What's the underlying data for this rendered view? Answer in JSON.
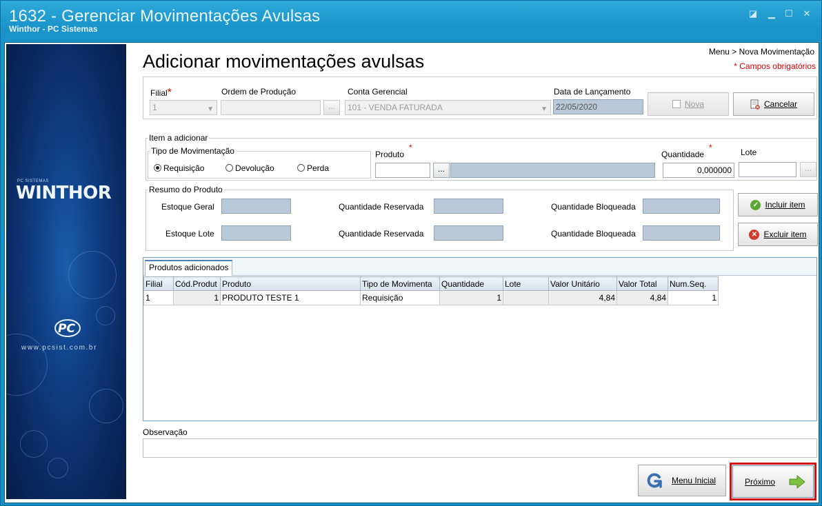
{
  "window": {
    "title": "1632 - Gerenciar Movimentações Avulsas",
    "subtitle": "Winthor - PC Sistemas"
  },
  "sidebar": {
    "brand_small": "PC SISTEMAS",
    "brand": "WINTHOR",
    "website": "www.pcsist.com.br"
  },
  "header": {
    "breadcrumb": "Menu > Nova Movimentação",
    "required_note": "* Campos obrigatórios",
    "page_title": "Adicionar movimentações avulsas"
  },
  "top_form": {
    "filial_label": "Filial",
    "filial_value": "1",
    "ordem_label": "Ordem de Produção",
    "ordem_value": "",
    "ordem_button": "...",
    "conta_label": "Conta Gerencial",
    "conta_value": "101 - VENDA FATURADA",
    "data_label": "Data de Lançamento",
    "data_value": "22/05/2020",
    "nova_button": "Nova",
    "cancelar_button": "Cancelar"
  },
  "item": {
    "legend": "Item a adicionar",
    "tipo_legend": "Tipo de Movimentação",
    "radios": [
      {
        "label": "Requisição",
        "selected": true
      },
      {
        "label": "Devolução",
        "selected": false
      },
      {
        "label": "Perda",
        "selected": false
      }
    ],
    "produto_label": "Produto",
    "produto_code": "",
    "produto_button": "...",
    "produto_desc": "",
    "quantidade_label": "Quantidade",
    "quantidade_value": "0,000000",
    "lote_label": "Lote",
    "lote_value": "",
    "lote_button": "..."
  },
  "resumo": {
    "legend": "Resumo do Produto",
    "estoque_geral": "Estoque Geral",
    "quantidade_reservada": "Quantidade Reservada",
    "quantidade_bloqueada": "Quantidade Bloqueada",
    "estoque_lote": "Estoque Lote",
    "incluir_button": "Incluir item",
    "excluir_button": "Excluir item"
  },
  "grid": {
    "tab_label": "Produtos adicionados",
    "columns": [
      "Filial",
      "Cód.Produt",
      "Produto",
      "Tipo de Movimenta",
      "Quantidade",
      "Lote",
      "Valor Unitário",
      "Valor Total",
      "Num.Seq."
    ],
    "rows": [
      [
        "1",
        "1",
        "PRODUTO TESTE 1",
        "Requisição",
        "1",
        "",
        "4,84",
        "4,84",
        "1"
      ]
    ]
  },
  "observacao": {
    "label": "Observação",
    "value": ""
  },
  "footer": {
    "menu_inicial_button": "Menu Inicial",
    "proximo_button": "Próximo"
  },
  "colors": {
    "titlebar": "#1993c8",
    "required": "#e00000",
    "highlight": "#d01010"
  }
}
